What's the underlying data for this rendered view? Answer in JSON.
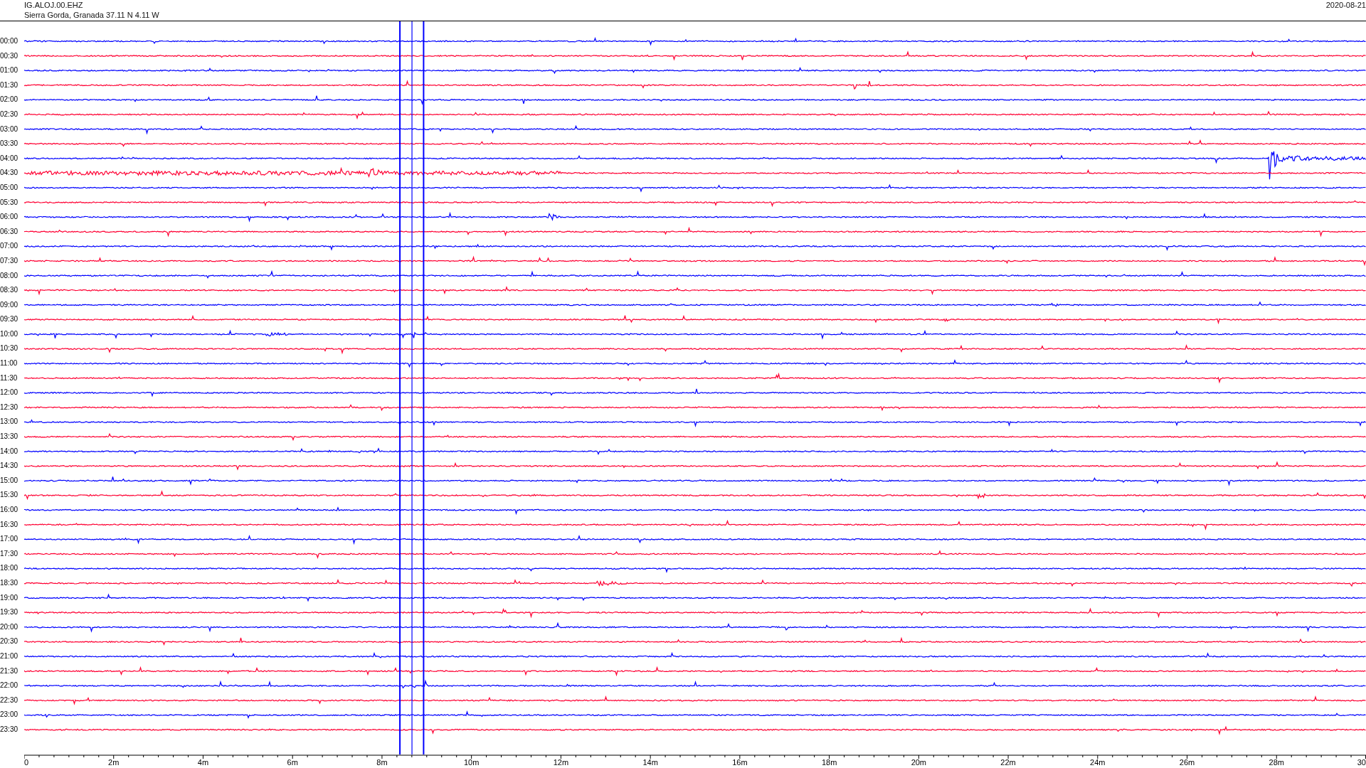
{
  "header": {
    "station": "IG.ALOJ.00.EHZ",
    "location": "Sierra Gorda, Granada  37.11 N 4.11 W",
    "date": "2020-08-21"
  },
  "rows": [
    {
      "label": "00:00",
      "color": "#0000ff"
    },
    {
      "label": "00:30",
      "color": "#ff0033"
    },
    {
      "label": "01:00",
      "color": "#0000ff"
    },
    {
      "label": "01:30",
      "color": "#ff0033"
    },
    {
      "label": "02:00",
      "color": "#0000ff"
    },
    {
      "label": "02:30",
      "color": "#ff0033"
    },
    {
      "label": "03:00",
      "color": "#0000ff"
    },
    {
      "label": "03:30",
      "color": "#ff0033"
    },
    {
      "label": "04:00",
      "color": "#0000ff"
    },
    {
      "label": "04:30",
      "color": "#ff0033"
    },
    {
      "label": "05:00",
      "color": "#0000ff"
    },
    {
      "label": "05:30",
      "color": "#ff0033"
    },
    {
      "label": "06:00",
      "color": "#0000ff"
    },
    {
      "label": "06:30",
      "color": "#ff0033"
    },
    {
      "label": "07:00",
      "color": "#0000ff"
    },
    {
      "label": "07:30",
      "color": "#ff0033"
    },
    {
      "label": "08:00",
      "color": "#0000ff"
    },
    {
      "label": "08:30",
      "color": "#ff0033"
    },
    {
      "label": "09:00",
      "color": "#0000ff"
    },
    {
      "label": "09:30",
      "color": "#ff0033"
    },
    {
      "label": "10:00",
      "color": "#0000ff"
    },
    {
      "label": "10:30",
      "color": "#ff0033"
    },
    {
      "label": "11:00",
      "color": "#0000ff"
    },
    {
      "label": "11:30",
      "color": "#ff0033"
    },
    {
      "label": "12:00",
      "color": "#0000ff"
    },
    {
      "label": "12:30",
      "color": "#ff0033"
    },
    {
      "label": "13:00",
      "color": "#0000ff"
    },
    {
      "label": "13:30",
      "color": "#ff0033"
    },
    {
      "label": "14:00",
      "color": "#0000ff"
    },
    {
      "label": "14:30",
      "color": "#ff0033"
    },
    {
      "label": "15:00",
      "color": "#0000ff"
    },
    {
      "label": "15:30",
      "color": "#ff0033"
    },
    {
      "label": "16:00",
      "color": "#0000ff"
    },
    {
      "label": "16:30",
      "color": "#ff0033"
    },
    {
      "label": "17:00",
      "color": "#0000ff"
    },
    {
      "label": "17:30",
      "color": "#ff0033"
    },
    {
      "label": "18:00",
      "color": "#0000ff"
    },
    {
      "label": "18:30",
      "color": "#ff0033"
    },
    {
      "label": "19:00",
      "color": "#0000ff"
    },
    {
      "label": "19:30",
      "color": "#ff0033"
    },
    {
      "label": "20:00",
      "color": "#0000ff"
    },
    {
      "label": "20:30",
      "color": "#ff0033"
    },
    {
      "label": "21:00",
      "color": "#0000ff"
    },
    {
      "label": "21:30",
      "color": "#ff0033"
    },
    {
      "label": "22:00",
      "color": "#0000ff"
    },
    {
      "label": "22:30",
      "color": "#ff0033"
    },
    {
      "label": "23:00",
      "color": "#0000ff"
    },
    {
      "label": "23:30",
      "color": "#ff0033"
    }
  ],
  "x_axis": {
    "ticks": [
      "0",
      "2m",
      "4m",
      "6m",
      "8m",
      "10m",
      "12m",
      "14m",
      "16m",
      "18m",
      "20m",
      "22m",
      "24m",
      "26m",
      "28m",
      "30"
    ]
  }
}
